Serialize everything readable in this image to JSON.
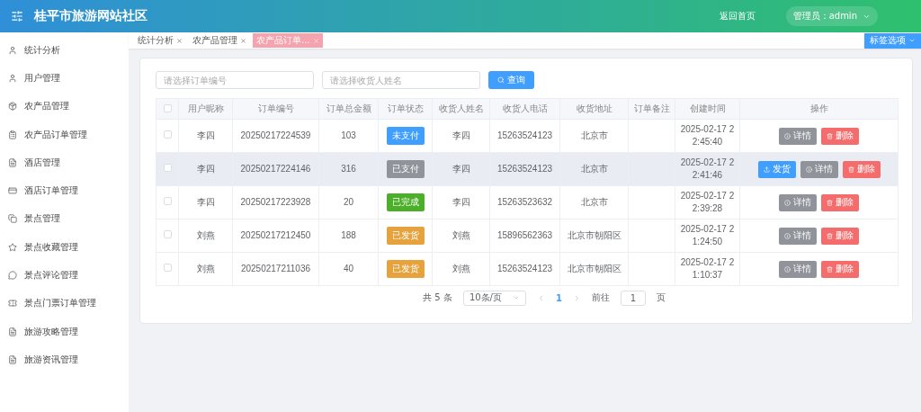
{
  "header": {
    "title": "桂平市旅游网站社区",
    "home_link": "返回首页",
    "user_menu": "管理员：admin"
  },
  "sidebar": {
    "items": [
      {
        "label": "统计分析"
      },
      {
        "label": "用户管理"
      },
      {
        "label": "农产品管理"
      },
      {
        "label": "农产品订单管理"
      },
      {
        "label": "酒店管理"
      },
      {
        "label": "酒店订单管理"
      },
      {
        "label": "景点管理"
      },
      {
        "label": "景点收藏管理"
      },
      {
        "label": "景点评论管理"
      },
      {
        "label": "景点门票订单管理"
      },
      {
        "label": "旅游攻略管理"
      },
      {
        "label": "旅游资讯管理"
      }
    ]
  },
  "tabs": [
    {
      "label": "统计分析",
      "selected": false
    },
    {
      "label": "农产品管理",
      "selected": false
    },
    {
      "label": "农产品订单...",
      "selected": true
    }
  ],
  "tab_options": "标签选项",
  "search": {
    "order_no": {
      "placeholder": "请选择订单编号"
    },
    "receiver": {
      "placeholder": "请选择收货人姓名"
    },
    "button": "查询"
  },
  "table": {
    "select_all_checked": false,
    "columns": [
      "用户昵称",
      "订单编号",
      "订单总金额",
      "订单状态",
      "收货人姓名",
      "收货人电话",
      "收货地址",
      "订单备注",
      "创建时间",
      "操作"
    ],
    "rows": [
      {
        "checked": false,
        "highlighted": false,
        "nickname": "李四",
        "order_no": "20250217224539",
        "amount": "103",
        "status": {
          "label": "未支付",
          "color": "#409eff"
        },
        "receiver": "李四",
        "phone": "15263524123",
        "address": "北京市",
        "created": [
          "2025-02-17 2",
          "2:45:40"
        ],
        "actions": [
          {
            "kind": "detail",
            "label": "详情"
          },
          {
            "kind": "delete",
            "label": "删除"
          }
        ]
      },
      {
        "checked": false,
        "highlighted": true,
        "nickname": "李四",
        "order_no": "20250217224146",
        "amount": "316",
        "status": {
          "label": "已支付",
          "color": "#909399"
        },
        "receiver": "李四",
        "phone": "15263524123",
        "address": "北京市",
        "created": [
          "2025-02-17 2",
          "2:41:46"
        ],
        "actions": [
          {
            "kind": "ship",
            "label": "发货"
          },
          {
            "kind": "detail",
            "label": "详情"
          },
          {
            "kind": "delete",
            "label": "删除"
          }
        ]
      },
      {
        "checked": false,
        "highlighted": false,
        "nickname": "李四",
        "order_no": "20250217223928",
        "amount": "20",
        "status": {
          "label": "已完成",
          "color": "#4caf2a"
        },
        "receiver": "李四",
        "phone": "15263523632",
        "address": "北京市",
        "created": [
          "2025-02-17 2",
          "2:39:28"
        ],
        "actions": [
          {
            "kind": "detail",
            "label": "详情"
          },
          {
            "kind": "delete",
            "label": "删除"
          }
        ]
      },
      {
        "checked": false,
        "highlighted": false,
        "nickname": "刘燕",
        "order_no": "20250217212450",
        "amount": "188",
        "status": {
          "label": "已发货",
          "color": "#e6a23c"
        },
        "receiver": "刘燕",
        "phone": "15896562363",
        "address": "北京市朝阳区",
        "created": [
          "2025-02-17 2",
          "1:24:50"
        ],
        "actions": [
          {
            "kind": "detail",
            "label": "详情"
          },
          {
            "kind": "delete",
            "label": "删除"
          }
        ]
      },
      {
        "checked": false,
        "highlighted": false,
        "nickname": "刘燕",
        "order_no": "20250217211036",
        "amount": "40",
        "status": {
          "label": "已发货",
          "color": "#e6a23c"
        },
        "receiver": "刘燕",
        "phone": "15263524123",
        "address": "北京市朝阳区",
        "created": [
          "2025-02-17 2",
          "1:10:37"
        ],
        "actions": [
          {
            "kind": "detail",
            "label": "详情"
          },
          {
            "kind": "delete",
            "label": "删除"
          }
        ]
      }
    ]
  },
  "pagination": {
    "total": "共 5 条",
    "page_size": "10条/页",
    "pages": [
      {
        "label": "1",
        "selected": true
      }
    ],
    "goto_label": "前往",
    "goto_value": "1",
    "goto_suffix": "页"
  }
}
